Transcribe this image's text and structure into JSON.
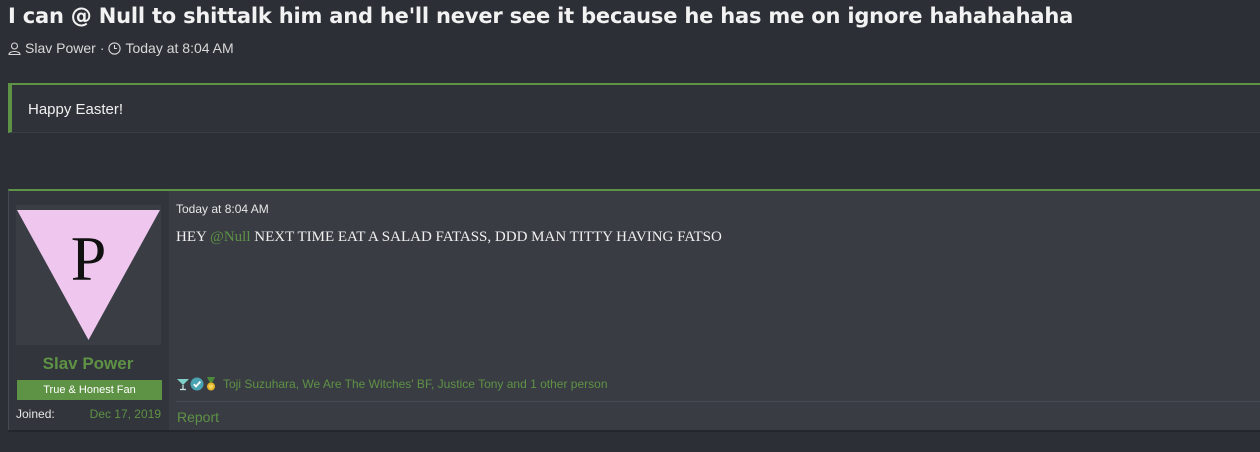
{
  "thread": {
    "title": "I can @ Null to shittalk him and he'll never see it because he has me on ignore hahahahaha",
    "author": "Slav Power",
    "separator": "·",
    "date": "Today at 8:04 AM"
  },
  "notice": {
    "text": "Happy Easter!"
  },
  "post": {
    "date": "Today at 8:04 AM",
    "body_pre": "HEY ",
    "mention": "@Null",
    "body_post": " NEXT TIME EAT A SALAD FATASS, DDD MAN TITTY HAVING FATSO",
    "reactions": {
      "icons": [
        "cocktail-icon",
        "check-badge-icon",
        "medal-icon"
      ],
      "text": "Toji Suzuhara, We Are The Witches' BF, Justice Tony and 1 other person"
    },
    "report_label": "Report"
  },
  "user": {
    "name": "Slav Power",
    "avatar_letter": "P",
    "title": "True & Honest Fan",
    "joined_label": "Joined:",
    "joined_value": "Dec 17, 2019"
  },
  "colors": {
    "accent": "#5e9245",
    "background": "#2c2f35",
    "post_bg": "#393c43",
    "avatar_triangle": "#eec6ee"
  }
}
